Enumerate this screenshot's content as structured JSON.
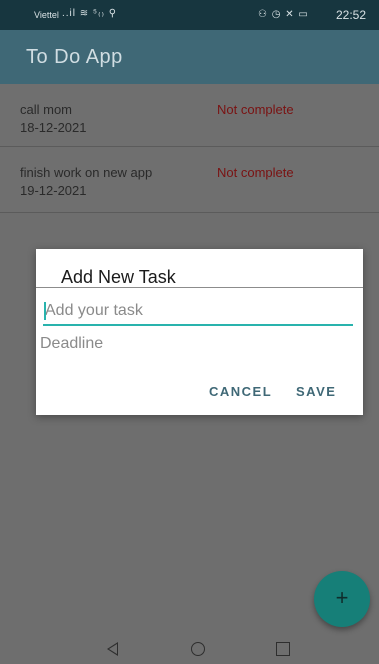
{
  "status_bar": {
    "carrier": "Viettel",
    "signal_icons": "..il ≋ ⁵₍₎ ⚲",
    "right_icons": "⚇ ◷ ✕ ▭",
    "time": "22:52"
  },
  "app_bar": {
    "title": "To Do App"
  },
  "tasks": [
    {
      "name": "call mom",
      "date": "18-12-2021",
      "status": "Not complete"
    },
    {
      "name": "finish work on new app",
      "date": "19-12-2021",
      "status": "Not complete"
    }
  ],
  "dialog": {
    "title": "Add New Task",
    "task_placeholder": "Add your task",
    "deadline_label": "Deadline",
    "cancel_label": "CANCEL",
    "save_label": "SAVE"
  },
  "fab": {
    "label": "+"
  },
  "colors": {
    "app_bar": "#3f6876",
    "status_bar": "#17363f",
    "accent": "#29b3ad",
    "fab": "#167f78",
    "status_text": "#7a1212"
  }
}
